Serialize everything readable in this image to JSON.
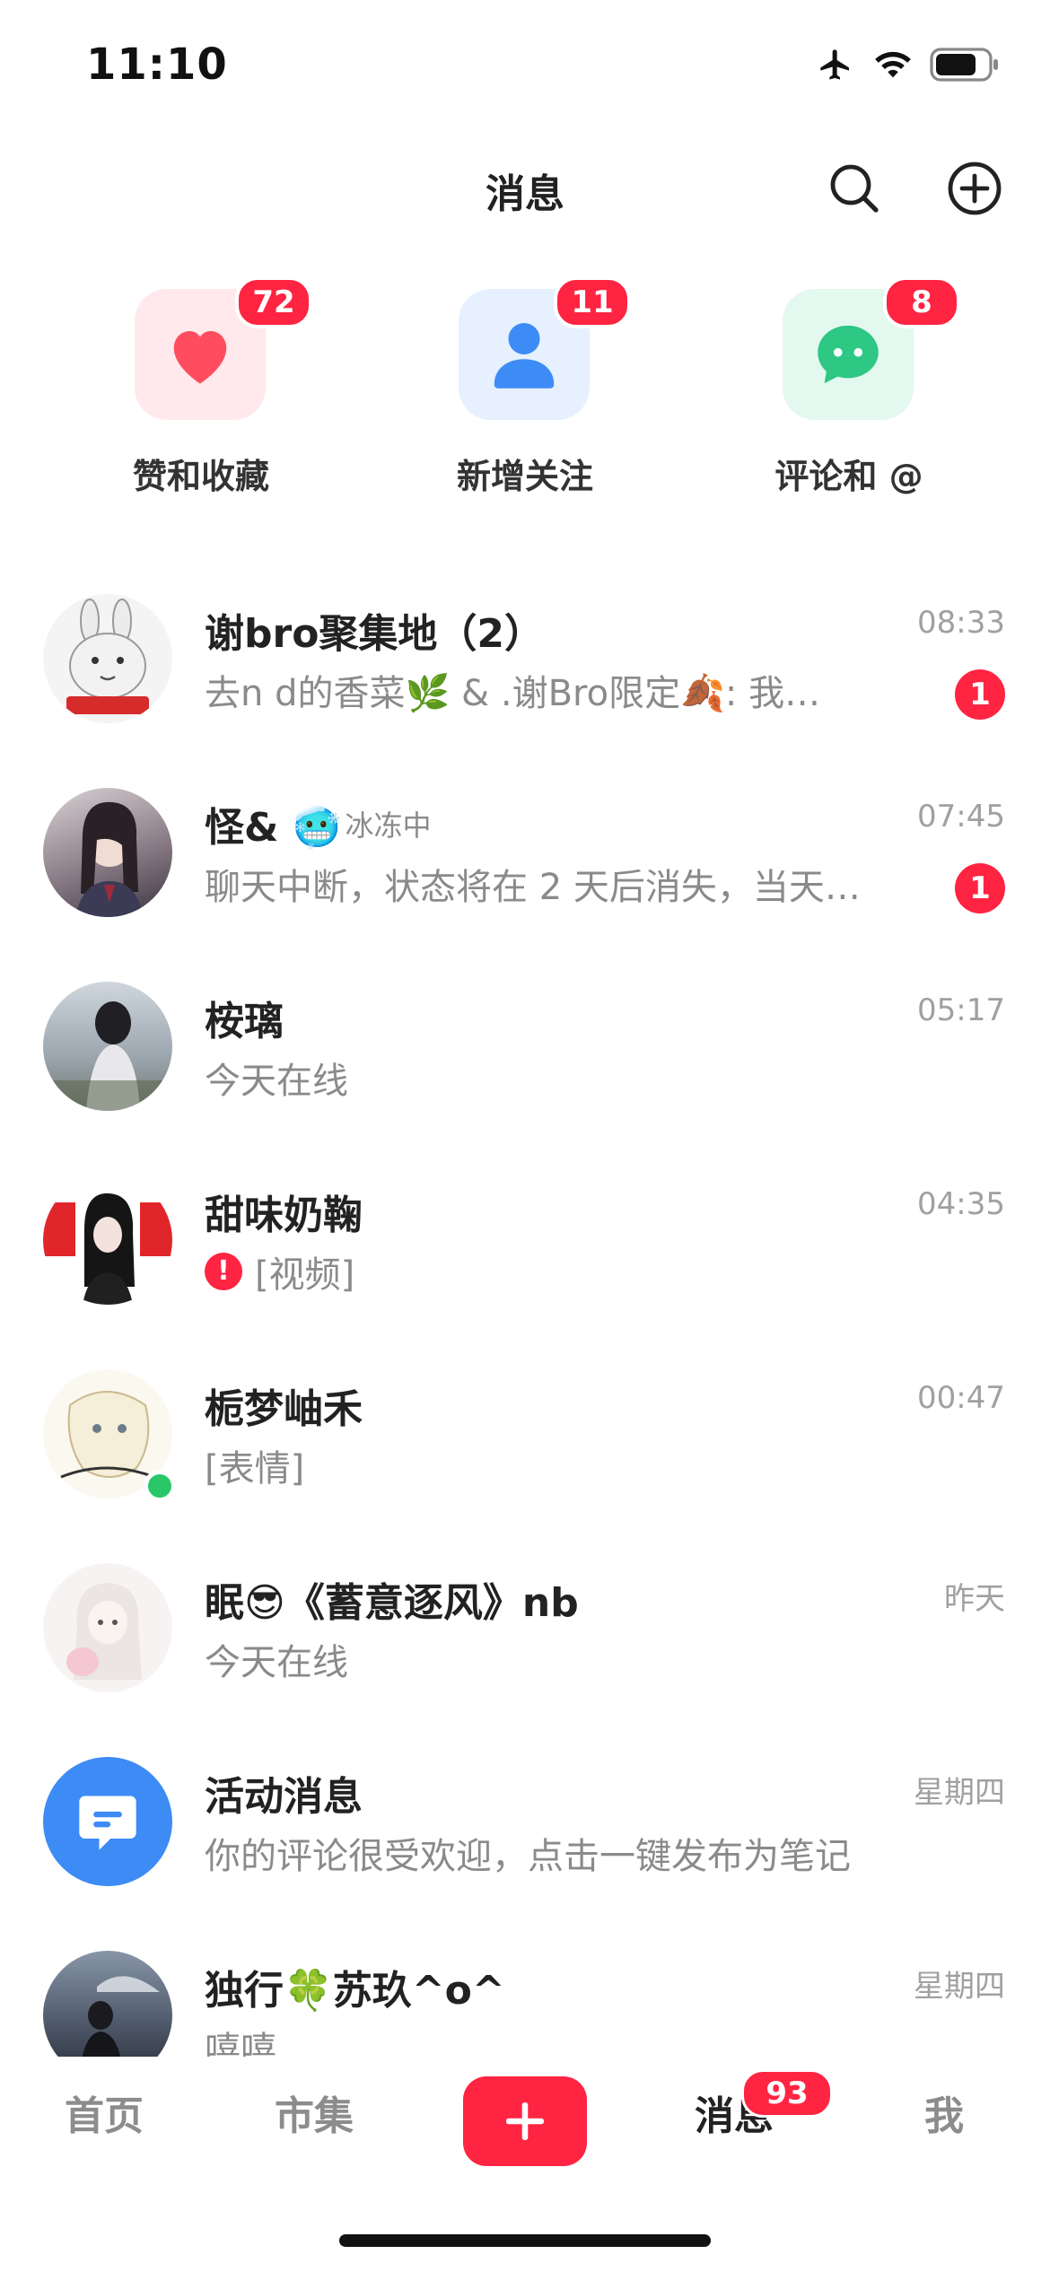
{
  "status_bar": {
    "time": "11:10"
  },
  "header": {
    "title": "消息"
  },
  "quick_actions": [
    {
      "label": "赞和收藏",
      "badge": "72",
      "icon": "heart-icon",
      "color": "#ff4d5f",
      "bg": "#ffe9ec"
    },
    {
      "label": "新增关注",
      "badge": "11",
      "icon": "person-icon",
      "color": "#3d8bf5",
      "bg": "#e6f0fe"
    },
    {
      "label": "评论和 @",
      "badge": "8",
      "icon": "chat-bubble-icon",
      "color": "#2ec784",
      "bg": "#e3f8ef"
    }
  ],
  "chats": [
    {
      "name": "谢bro聚集地（2）",
      "preview": "去n d的香菜🌿 & .谢Bro限定🍂: 我…",
      "time": "08:33",
      "unread": "1"
    },
    {
      "name": "怪& 🥶",
      "tag": "冰冻中",
      "preview": "聊天中断，状态将在 2 天后消失，当天…",
      "time": "07:45",
      "unread": "1"
    },
    {
      "name": "桉璃",
      "preview": "今天在线",
      "time": "05:17"
    },
    {
      "name": "甜味奶鞠",
      "preview": "[视频]",
      "time": "04:35",
      "error_mark": "!"
    },
    {
      "name": "栀梦岫禾",
      "preview": "[表情]",
      "time": "00:47",
      "online": true
    },
    {
      "name": "眠😎《蓄意逐风》nb",
      "preview": "今天在线",
      "time": "昨天"
    },
    {
      "name": "活动消息",
      "preview": "你的评论很受欢迎，点击一键发布为笔记",
      "time": "星期四"
    },
    {
      "name": "独行🍀苏玖^o^",
      "preview": "嘻嘻",
      "time": "星期四"
    }
  ],
  "tab_bar": {
    "home": "首页",
    "market": "市集",
    "messages": "消息",
    "messages_badge": "93",
    "me": "我"
  },
  "colors": {
    "accent": "#ff2442",
    "online": "#2ac769",
    "activity": "#3d8bf5"
  }
}
